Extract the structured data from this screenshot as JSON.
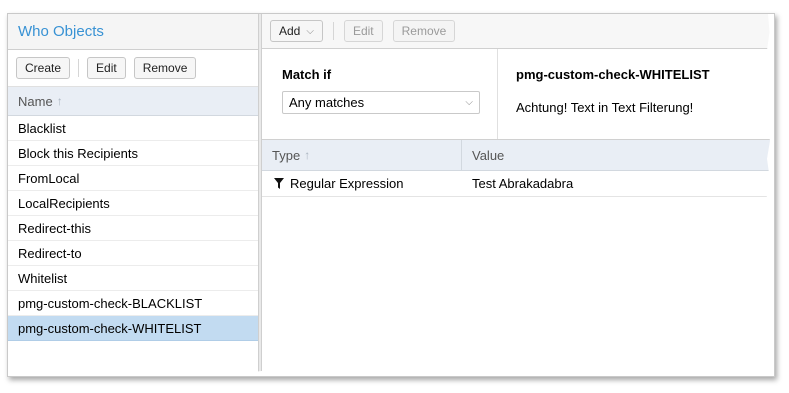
{
  "left_panel": {
    "title": "Who Objects",
    "toolbar": {
      "create": "Create",
      "edit": "Edit",
      "remove": "Remove"
    },
    "column_header": "Name",
    "items": [
      {
        "label": "Blacklist"
      },
      {
        "label": "Block this Recipients"
      },
      {
        "label": "FromLocal"
      },
      {
        "label": "LocalRecipients"
      },
      {
        "label": "Redirect-this"
      },
      {
        "label": "Redirect-to"
      },
      {
        "label": "Whitelist"
      },
      {
        "label": "pmg-custom-check-BLACKLIST"
      },
      {
        "label": "pmg-custom-check-WHITELIST",
        "selected": true
      }
    ]
  },
  "right_panel": {
    "toolbar": {
      "add": "Add",
      "edit": "Edit",
      "remove": "Remove"
    },
    "match_label": "Match if",
    "match_value": "Any matches",
    "object_name": "pmg-custom-check-WHITELIST",
    "object_description": "Achtung! Text in Text Filterung!",
    "grid": {
      "columns": {
        "type": "Type",
        "value": "Value"
      },
      "rows": [
        {
          "type": "Regular Expression",
          "value": "Test Abrakadabra",
          "icon": "filter-icon"
        }
      ]
    }
  },
  "colors": {
    "accent": "#3892d4",
    "selection": "#c2dbf1",
    "header_bg": "#e9eef5"
  }
}
